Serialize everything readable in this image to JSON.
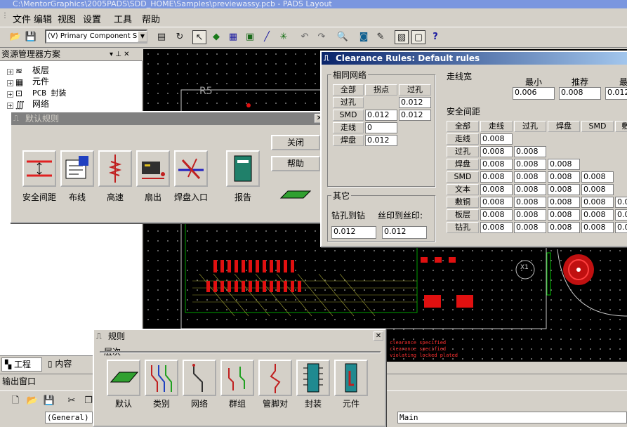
{
  "window": {
    "title": "C:\\MentorGraphics\\2005PADS\\SDD_HOME\\Samples\\previewassy.pcb - PADS Layout"
  },
  "menu": [
    "文件",
    "编辑",
    "视图",
    "设置",
    "工具",
    "帮助"
  ],
  "toolbar": {
    "layer_select": "(V) Primary Component Side"
  },
  "explorer": {
    "title": "资源管理器方案",
    "items": [
      "板层",
      "元件",
      "PCB 封装",
      "网络"
    ],
    "tabs": [
      "工程",
      "内容"
    ]
  },
  "output": {
    "title": "输出窗口",
    "general": "(General)",
    "main": "Main"
  },
  "canvas": {
    "label_r5": "R5",
    "label_x1": "X1"
  },
  "default_rules": {
    "title": "默认规则",
    "icons": [
      "安全间距",
      "布线",
      "高速",
      "扇出",
      "焊盘入口",
      "报告"
    ],
    "close": "关闭",
    "help": "帮助"
  },
  "rules": {
    "title": "规则",
    "section": "层次",
    "icons": [
      "默认",
      "类别",
      "网络",
      "群组",
      "管脚对",
      "封装",
      "元件"
    ]
  },
  "clearance": {
    "title": "Clearance Rules: Default rules",
    "same_net": {
      "label": "相同网络",
      "headers": [
        "全部",
        "拐点",
        "过孔"
      ],
      "rows": [
        {
          "name": "过孔",
          "vals": [
            "",
            "0.012"
          ]
        },
        {
          "name": "SMD",
          "vals": [
            "0.012",
            "0.012"
          ]
        },
        {
          "name": "走线",
          "vals": [
            "0",
            ""
          ]
        },
        {
          "name": "焊盘",
          "vals": [
            "0.012",
            ""
          ]
        }
      ]
    },
    "trace_width": {
      "label": "走线宽",
      "headers": [
        "最小",
        "推荐",
        "最"
      ],
      "values": [
        "0.006",
        "0.008",
        "0.012"
      ]
    },
    "safety": {
      "label": "安全间距",
      "headers": [
        "全部",
        "走线",
        "过孔",
        "焊盘",
        "SMD",
        "敷"
      ],
      "rows": [
        {
          "name": "走线",
          "vals": [
            "0.008",
            "",
            "",
            "",
            ""
          ]
        },
        {
          "name": "过孔",
          "vals": [
            "0.008",
            "0.008",
            "",
            "",
            ""
          ]
        },
        {
          "name": "焊盘",
          "vals": [
            "0.008",
            "0.008",
            "0.008",
            "",
            ""
          ]
        },
        {
          "name": "SMD",
          "vals": [
            "0.008",
            "0.008",
            "0.008",
            "0.008",
            ""
          ]
        },
        {
          "name": "文本",
          "vals": [
            "0.008",
            "0.008",
            "0.008",
            "0.008",
            ""
          ]
        },
        {
          "name": "敷铜",
          "vals": [
            "0.008",
            "0.008",
            "0.008",
            "0.008",
            "0.0"
          ]
        },
        {
          "name": "板层",
          "vals": [
            "0.008",
            "0.008",
            "0.008",
            "0.008",
            "0.0"
          ]
        },
        {
          "name": "钻孔",
          "vals": [
            "0.008",
            "0.008",
            "0.008",
            "0.008",
            "0.0"
          ]
        }
      ]
    },
    "other": {
      "label": "其它",
      "drill_to_drill": "钻孔到钻",
      "silk_to_silk": "丝印到丝印:",
      "values": [
        "0.012",
        "0.012"
      ]
    }
  },
  "colors": {
    "board_bg": "#000000",
    "trace_green": "#00c000",
    "pad_red": "#e01010",
    "active_title": "#0a246a"
  }
}
